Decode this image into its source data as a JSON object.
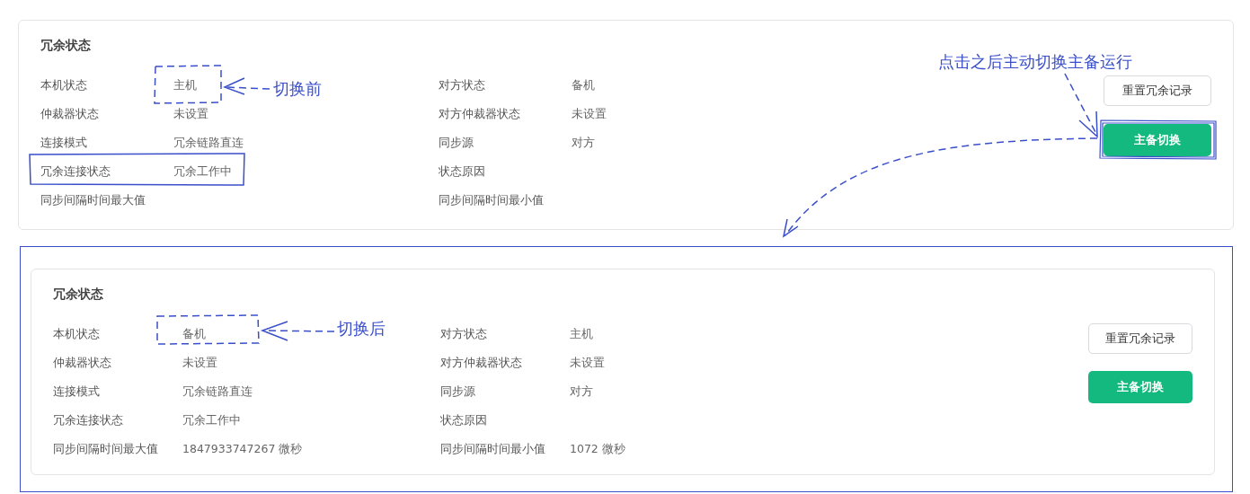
{
  "panels": [
    {
      "title": "冗余状态",
      "framed": false,
      "left": [
        {
          "label": "本机状态",
          "value": "主机"
        },
        {
          "label": "仲裁器状态",
          "value": "未设置"
        },
        {
          "label": "连接模式",
          "value": "冗余链路直连"
        },
        {
          "label": "冗余连接状态",
          "value": "冗余工作中"
        },
        {
          "label": "同步间隔时间最大值"
        }
      ],
      "right": [
        {
          "label": "对方状态",
          "value": "备机"
        },
        {
          "label": "对方仲裁器状态",
          "value": "未设置"
        },
        {
          "label": "同步源",
          "value": "对方"
        },
        {
          "label": "状态原因"
        },
        {
          "label": "同步间隔时间最小值"
        }
      ],
      "buttons": [
        {
          "label": "重置冗余记录",
          "kind": "default"
        },
        {
          "label": "主备切换",
          "kind": "primary"
        }
      ]
    },
    {
      "title": "冗余状态",
      "framed": true,
      "left": [
        {
          "label": "本机状态",
          "value": "备机"
        },
        {
          "label": "仲裁器状态",
          "value": "未设置"
        },
        {
          "label": "连接模式",
          "value": "冗余链路直连"
        },
        {
          "label": "冗余连接状态",
          "value": "冗余工作中"
        },
        {
          "label": "同步间隔时间最大值",
          "value": "1847933747267 微秒"
        }
      ],
      "right": [
        {
          "label": "对方状态",
          "value": "主机"
        },
        {
          "label": "对方仲裁器状态",
          "value": "未设置"
        },
        {
          "label": "同步源",
          "value": "对方"
        },
        {
          "label": "状态原因"
        },
        {
          "label": "同步间隔时间最小值",
          "value": "1072 微秒"
        }
      ],
      "buttons": [
        {
          "label": "重置冗余记录",
          "kind": "default"
        },
        {
          "label": "主备切换",
          "kind": "primary"
        }
      ]
    }
  ],
  "annotations": [
    {
      "text": "切换前"
    },
    {
      "text": "点击之后主动切换主备运行"
    },
    {
      "text": "切换后"
    }
  ]
}
